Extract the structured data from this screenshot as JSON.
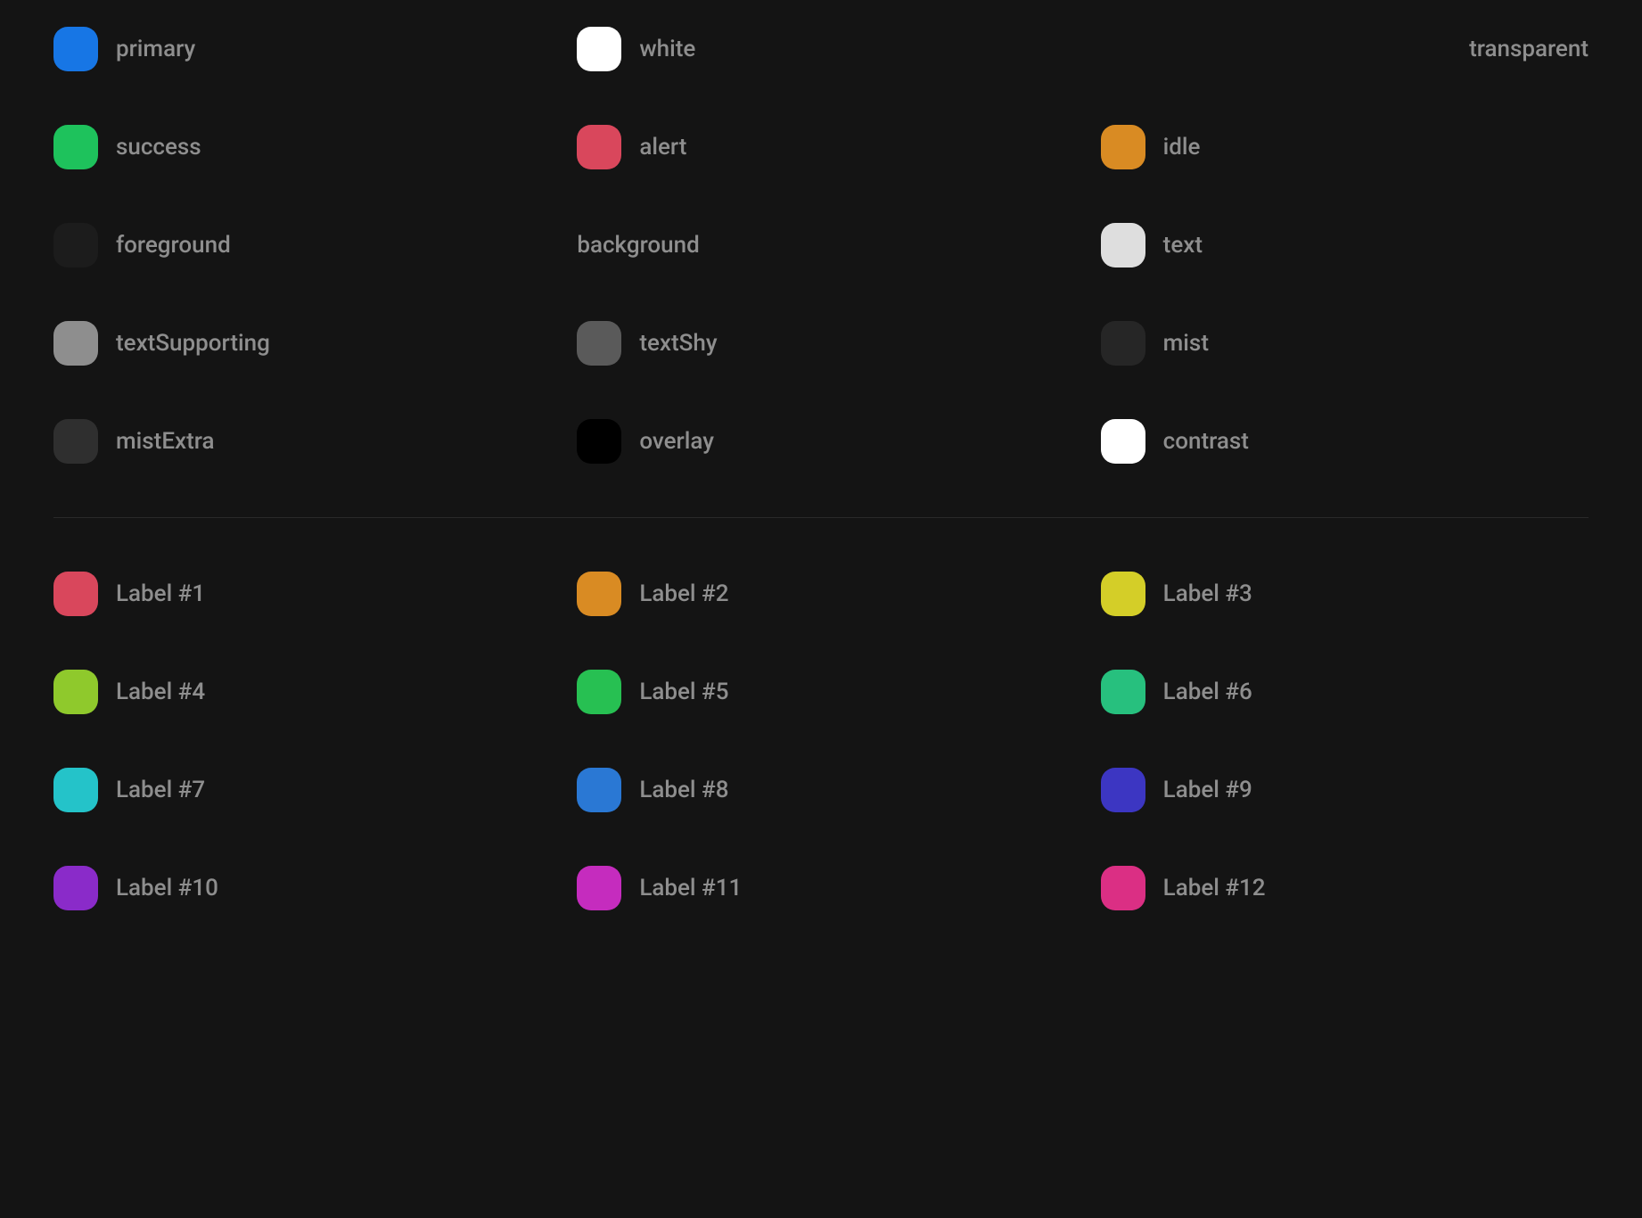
{
  "systemColors": [
    {
      "label": "primary",
      "color": "#1776e5",
      "showSwatch": true
    },
    {
      "label": "white",
      "color": "#ffffff",
      "showSwatch": true
    },
    {
      "label": "transparent",
      "color": null,
      "showSwatch": false
    },
    {
      "label": "success",
      "color": "#1ec25c",
      "showSwatch": true
    },
    {
      "label": "alert",
      "color": "#d9475c",
      "showSwatch": true
    },
    {
      "label": "idle",
      "color": "#d98b23",
      "showSwatch": true
    },
    {
      "label": "foreground",
      "color": "#1c1c1c",
      "showSwatch": true
    },
    {
      "label": "background",
      "color": null,
      "showSwatch": false
    },
    {
      "label": "text",
      "color": "#dedede",
      "showSwatch": true
    },
    {
      "label": "textSupporting",
      "color": "#8e8e8e",
      "showSwatch": true
    },
    {
      "label": "textShy",
      "color": "#5a5a5a",
      "showSwatch": true
    },
    {
      "label": "mist",
      "color": "#262626",
      "showSwatch": true
    },
    {
      "label": "mistExtra",
      "color": "#2f2f2f",
      "showSwatch": true
    },
    {
      "label": "overlay",
      "color": "#000000",
      "showSwatch": true
    },
    {
      "label": "contrast",
      "color": "#ffffff",
      "showSwatch": true
    }
  ],
  "labelColors": [
    {
      "label": "Label #1",
      "color": "#d9475c"
    },
    {
      "label": "Label #2",
      "color": "#d98b23"
    },
    {
      "label": "Label #3",
      "color": "#d4ce28"
    },
    {
      "label": "Label #4",
      "color": "#8fc92c"
    },
    {
      "label": "Label #5",
      "color": "#27c052"
    },
    {
      "label": "Label #6",
      "color": "#27c07e"
    },
    {
      "label": "Label #7",
      "color": "#24c3c9"
    },
    {
      "label": "Label #8",
      "color": "#2a78d4"
    },
    {
      "label": "Label #9",
      "color": "#3c36c2"
    },
    {
      "label": "Label #10",
      "color": "#8a2bc9"
    },
    {
      "label": "Label #11",
      "color": "#c52cbe"
    },
    {
      "label": "Label #12",
      "color": "#db2f84"
    }
  ]
}
